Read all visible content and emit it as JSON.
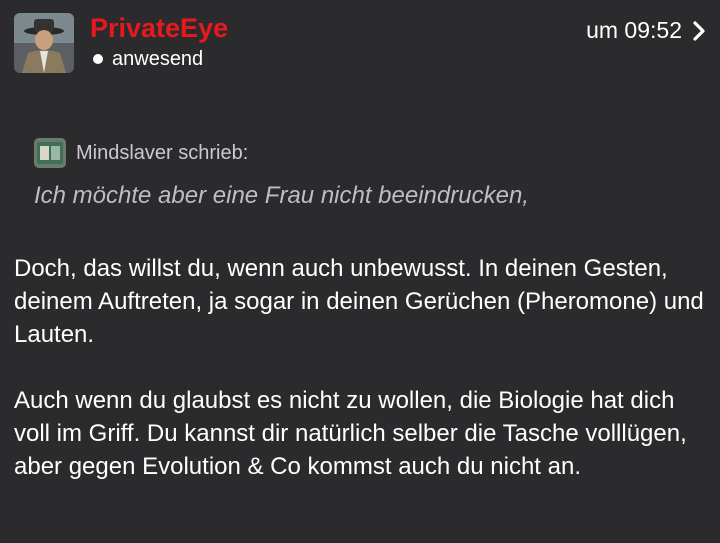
{
  "post": {
    "username": "PrivateEye",
    "status": "anwesend",
    "time": "um 09:52"
  },
  "quote": {
    "author": "Mindslaver schrieb:",
    "text": "Ich möchte aber eine Frau nicht beeindrucken,"
  },
  "body": {
    "paragraph_1": "Doch, das willst du, wenn auch unbewusst. In deinen Gesten, deinem Auftreten, ja sogar in deinen Gerüchen (Pheromone) und Lauten.",
    "paragraph_2": "Auch wenn du glaubst es nicht zu wollen, die Biologie hat dich voll im Griff. Du kannst dir natürlich selber die Tasche volllügen, aber gegen Evolution & Co kommst auch du nicht an."
  },
  "colors": {
    "background": "#2b2b2d",
    "username": "#e8191e",
    "quote_text": "#bdbdc6"
  },
  "icons": {
    "avatar": "user-avatar",
    "quote_avatar": "quoted-user-avatar",
    "chevron": "chevron-right-icon",
    "status": "online-dot-icon"
  }
}
